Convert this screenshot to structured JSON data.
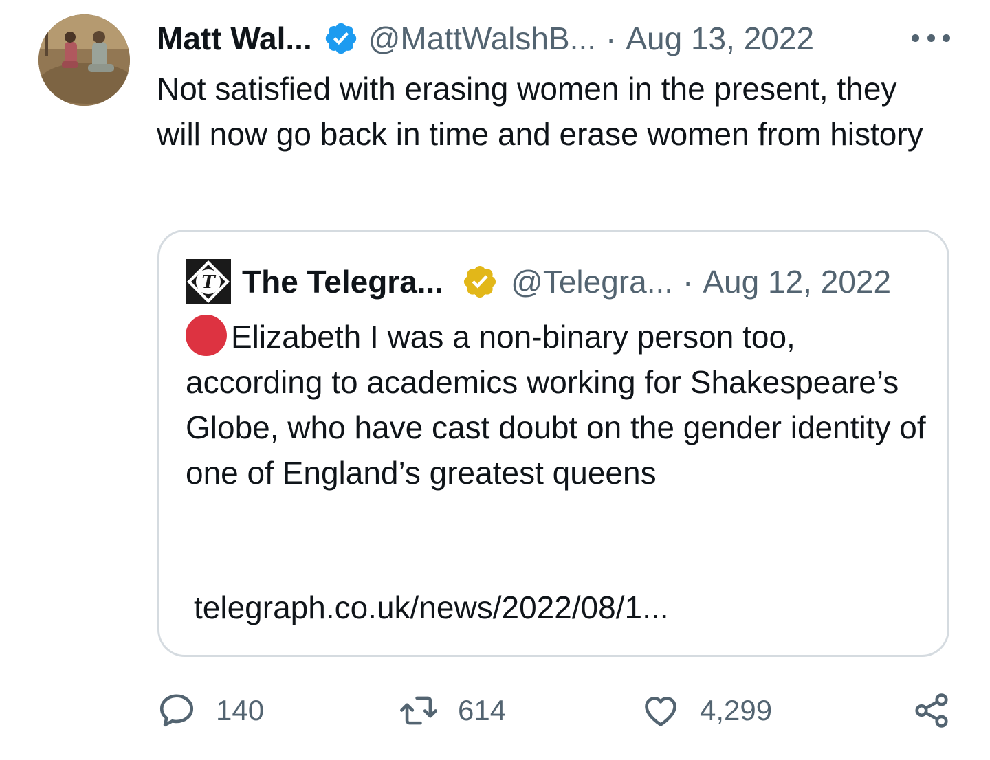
{
  "author": {
    "name": "Matt Wal...",
    "handle": "@MattWalshB...",
    "separator": "·",
    "date": "Aug 13, 2022",
    "verified_color": "#1d9bf0",
    "avatar_icon": "profile-photo"
  },
  "tweet": {
    "text": "Not satisfied with erasing women in the present, they will now go back in time and erase women from history"
  },
  "quoted": {
    "name": "The Telegra...",
    "handle": "@Telegra...",
    "separator": "·",
    "date": "Aug 12, 2022",
    "verified_color": "#e2b719",
    "logo_icon": "telegraph-logo",
    "text": "Elizabeth I was a non-binary person too, according to academics working for Shakespeare’s Globe, who have cast doubt on the gender identity of one of England’s greatest queens",
    "link": "telegraph.co.uk/news/2022/08/1...",
    "leading_emoji": "red-circle",
    "emoji_color": "#dd3341"
  },
  "actions": {
    "replies": "140",
    "retweets": "614",
    "likes": "4,299",
    "reply_icon": "comment-icon",
    "retweet_icon": "retweet-icon",
    "like_icon": "heart-icon",
    "share_icon": "share-icon"
  },
  "colors": {
    "text": "#0f1419",
    "secondary": "#536471",
    "border": "#d5dbe0"
  }
}
